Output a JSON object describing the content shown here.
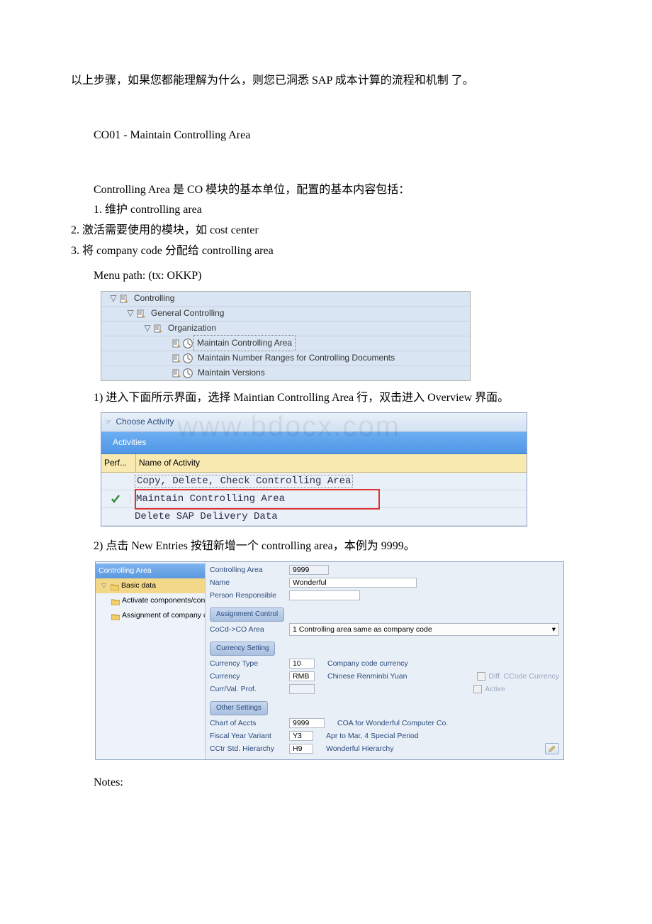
{
  "intro": "以上步骤，如果您都能理解为什么，则您已洞悉 SAP 成本计算的流程和机制 了。",
  "section_title": "CO01 - Maintain Controlling Area",
  "ca_desc": "Controlling Area 是 CO 模块的基本单位，配置的基本内容包括：",
  "ca_list": [
    "1. 维护 controlling area",
    "2. 激活需要使用的模块，如 cost center",
    "3. 将 company code 分配给 controlling area"
  ],
  "menu_path": "Menu path: (tx: OKKP)",
  "tree": {
    "controlling": "Controlling",
    "general": "General Controlling",
    "org": "Organization",
    "maintain_ca": "Maintain Controlling Area",
    "maintain_nr": "Maintain Number Ranges for Controlling Documents",
    "maintain_ver": "Maintain Versions"
  },
  "step1": "1) 进入下面所示界面，选择 Maintian Controlling Area 行，双击进入 Overview 界面。",
  "watermark": "www.bdocx.com",
  "activity": {
    "title": "Choose Activity",
    "sub": "Activities",
    "col1": "Perf...",
    "col2": "Name of Activity",
    "rows": [
      "Copy, Delete, Check Controlling Area",
      "Maintain Controlling Area",
      "Delete SAP Delivery Data"
    ]
  },
  "step2": "2) 点击 New Entries 按钮新增一个 controlling area，本例为 9999。",
  "form": {
    "left_header": "Controlling Area",
    "left_nodes": {
      "basic": "Basic data",
      "act": "Activate components/con",
      "assign": "Assignment of company c"
    },
    "basic": {
      "controlling_area_lbl": "Controlling Area",
      "controlling_area_val": "9999",
      "name_lbl": "Name",
      "name_val": "Wonderful",
      "person_lbl": "Person Responsible",
      "person_val": ""
    },
    "assign_ctrl": {
      "group": "Assignment Control",
      "cocd_lbl": "CoCd->CO Area",
      "cocd_val": "1 Controlling area same as company code"
    },
    "currency": {
      "group": "Currency Setting",
      "type_lbl": "Currency Type",
      "type_val": "10",
      "type_desc": "Company code currency",
      "curr_lbl": "Currency",
      "curr_val": "RMB",
      "curr_desc": "Chinese Renminbi Yuan",
      "diff_lbl": "Diff. CCode Currency",
      "prof_lbl": "Curr/Val. Prof.",
      "prof_val": "",
      "active_lbl": "Active"
    },
    "other": {
      "group": "Other Settings",
      "coa_lbl": "Chart of Accts",
      "coa_val": "9999",
      "coa_desc": "COA for Wonderful Computer Co.",
      "fyv_lbl": "Fiscal Year Variant",
      "fyv_val": "Y3",
      "fyv_desc": "Apr to Mar, 4 Special Period",
      "hier_lbl": "CCtr Std. Hierarchy",
      "hier_val": "H9",
      "hier_desc": "Wonderful Hierarchy"
    }
  },
  "notes": "Notes:"
}
